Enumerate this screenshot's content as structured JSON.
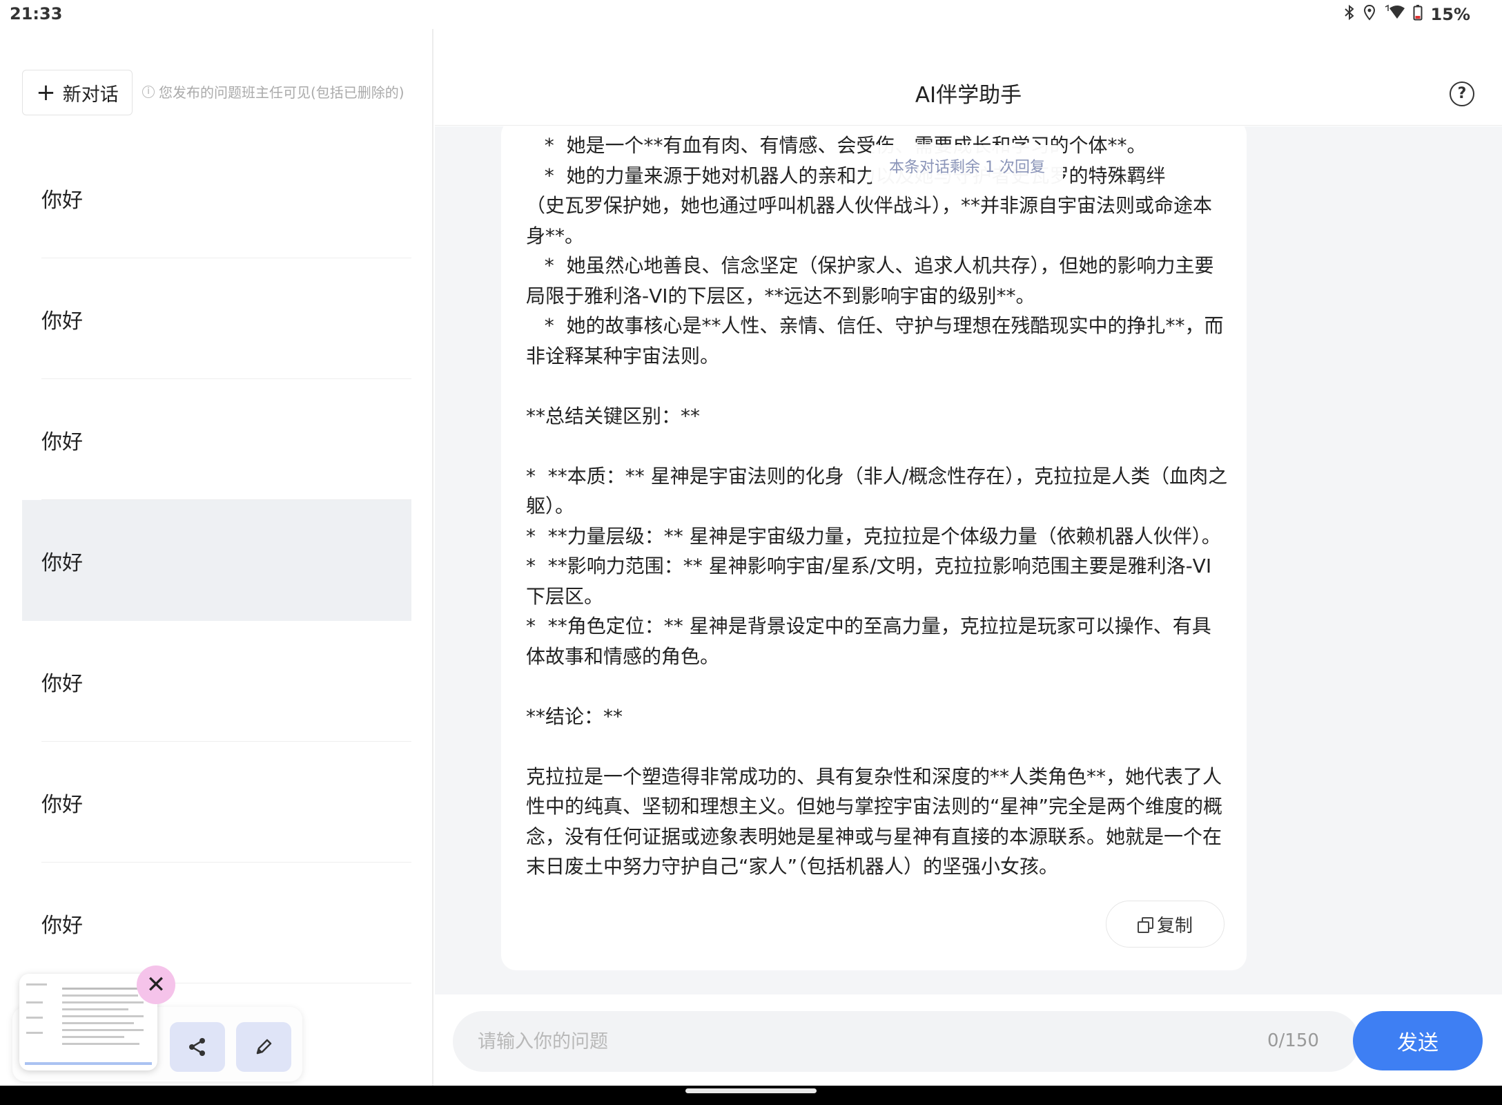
{
  "status_bar": {
    "time": "21:33",
    "icons": [
      "bluetooth-icon",
      "location-icon",
      "wifi-icon",
      "battery-icon"
    ],
    "battery": "15%"
  },
  "sidebar": {
    "new_chat_label": "新对话",
    "notice": "您发布的问题班主任可见(包括已删除的)",
    "items": [
      {
        "label": "你好",
        "active": false
      },
      {
        "label": "你好",
        "active": false
      },
      {
        "label": "你好",
        "active": false
      },
      {
        "label": "你好",
        "active": true
      },
      {
        "label": "你好",
        "active": false
      },
      {
        "label": "你好",
        "active": false
      },
      {
        "label": "你好",
        "active": false
      }
    ]
  },
  "header": {
    "title": "AI伴学助手"
  },
  "chat": {
    "toast": "本条对话剩余 1 次回复",
    "message_lines": [
      "   *  她是一个**有血有肉、有情感、会受伤、需要成长和学习的个体**。",
      "   *  她的力量来源于她对机器人的亲和力以及她与守护者史瓦罗的特殊羁绊",
      "（史瓦罗保护她，她也通过呼叫机器人伙伴战斗），**并非源自宇宙法则或命途本",
      "身**。",
      "   *  她虽然心地善良、信念坚定（保护家人、追求人机共存），但她的影响力主要",
      "局限于雅利洛-VI的下层区，**远达不到影响宇宙的级别**。",
      "   *  她的故事核心是**人性、亲情、信任、守护与理想在残酷现实中的挣扎**，而",
      "非诠释某种宇宙法则。",
      "",
      "**总结关键区别：**",
      "",
      "*  **本质：** 星神是宇宙法则的化身（非人/概念性存在），克拉拉是人类（血肉之",
      "躯）。",
      "*  **力量层级：** 星神是宇宙级力量，克拉拉是个体级力量（依赖机器人伙伴）。",
      "*  **影响力范围：** 星神影响宇宙/星系/文明，克拉拉影响范围主要是雅利洛-VI",
      "下层区。",
      "*  **角色定位：** 星神是背景设定中的至高力量，克拉拉是玩家可以操作、有具",
      "体故事和情感的角色。",
      "",
      "**结论：**",
      "",
      "克拉拉是一个塑造得非常成功的、具有复杂性和深度的**人类角色**，她代表了人",
      "性中的纯真、坚韧和理想主义。但她与掌控宇宙法则的“星神”完全是两个维度的概",
      "念，没有任何证据或迹象表明她是星神或与星神有直接的本源联系。她就是一个在",
      "末日废土中努力守护自己“家人”（包括机器人）的坚强小女孩。"
    ],
    "copy_label": "复制"
  },
  "input": {
    "placeholder": "请输入你的问题",
    "value": "",
    "counter": "0/150",
    "send_label": "发送"
  },
  "floating_toolbar": {
    "icons": [
      "close-icon",
      "share-icon",
      "edit-icon"
    ]
  }
}
